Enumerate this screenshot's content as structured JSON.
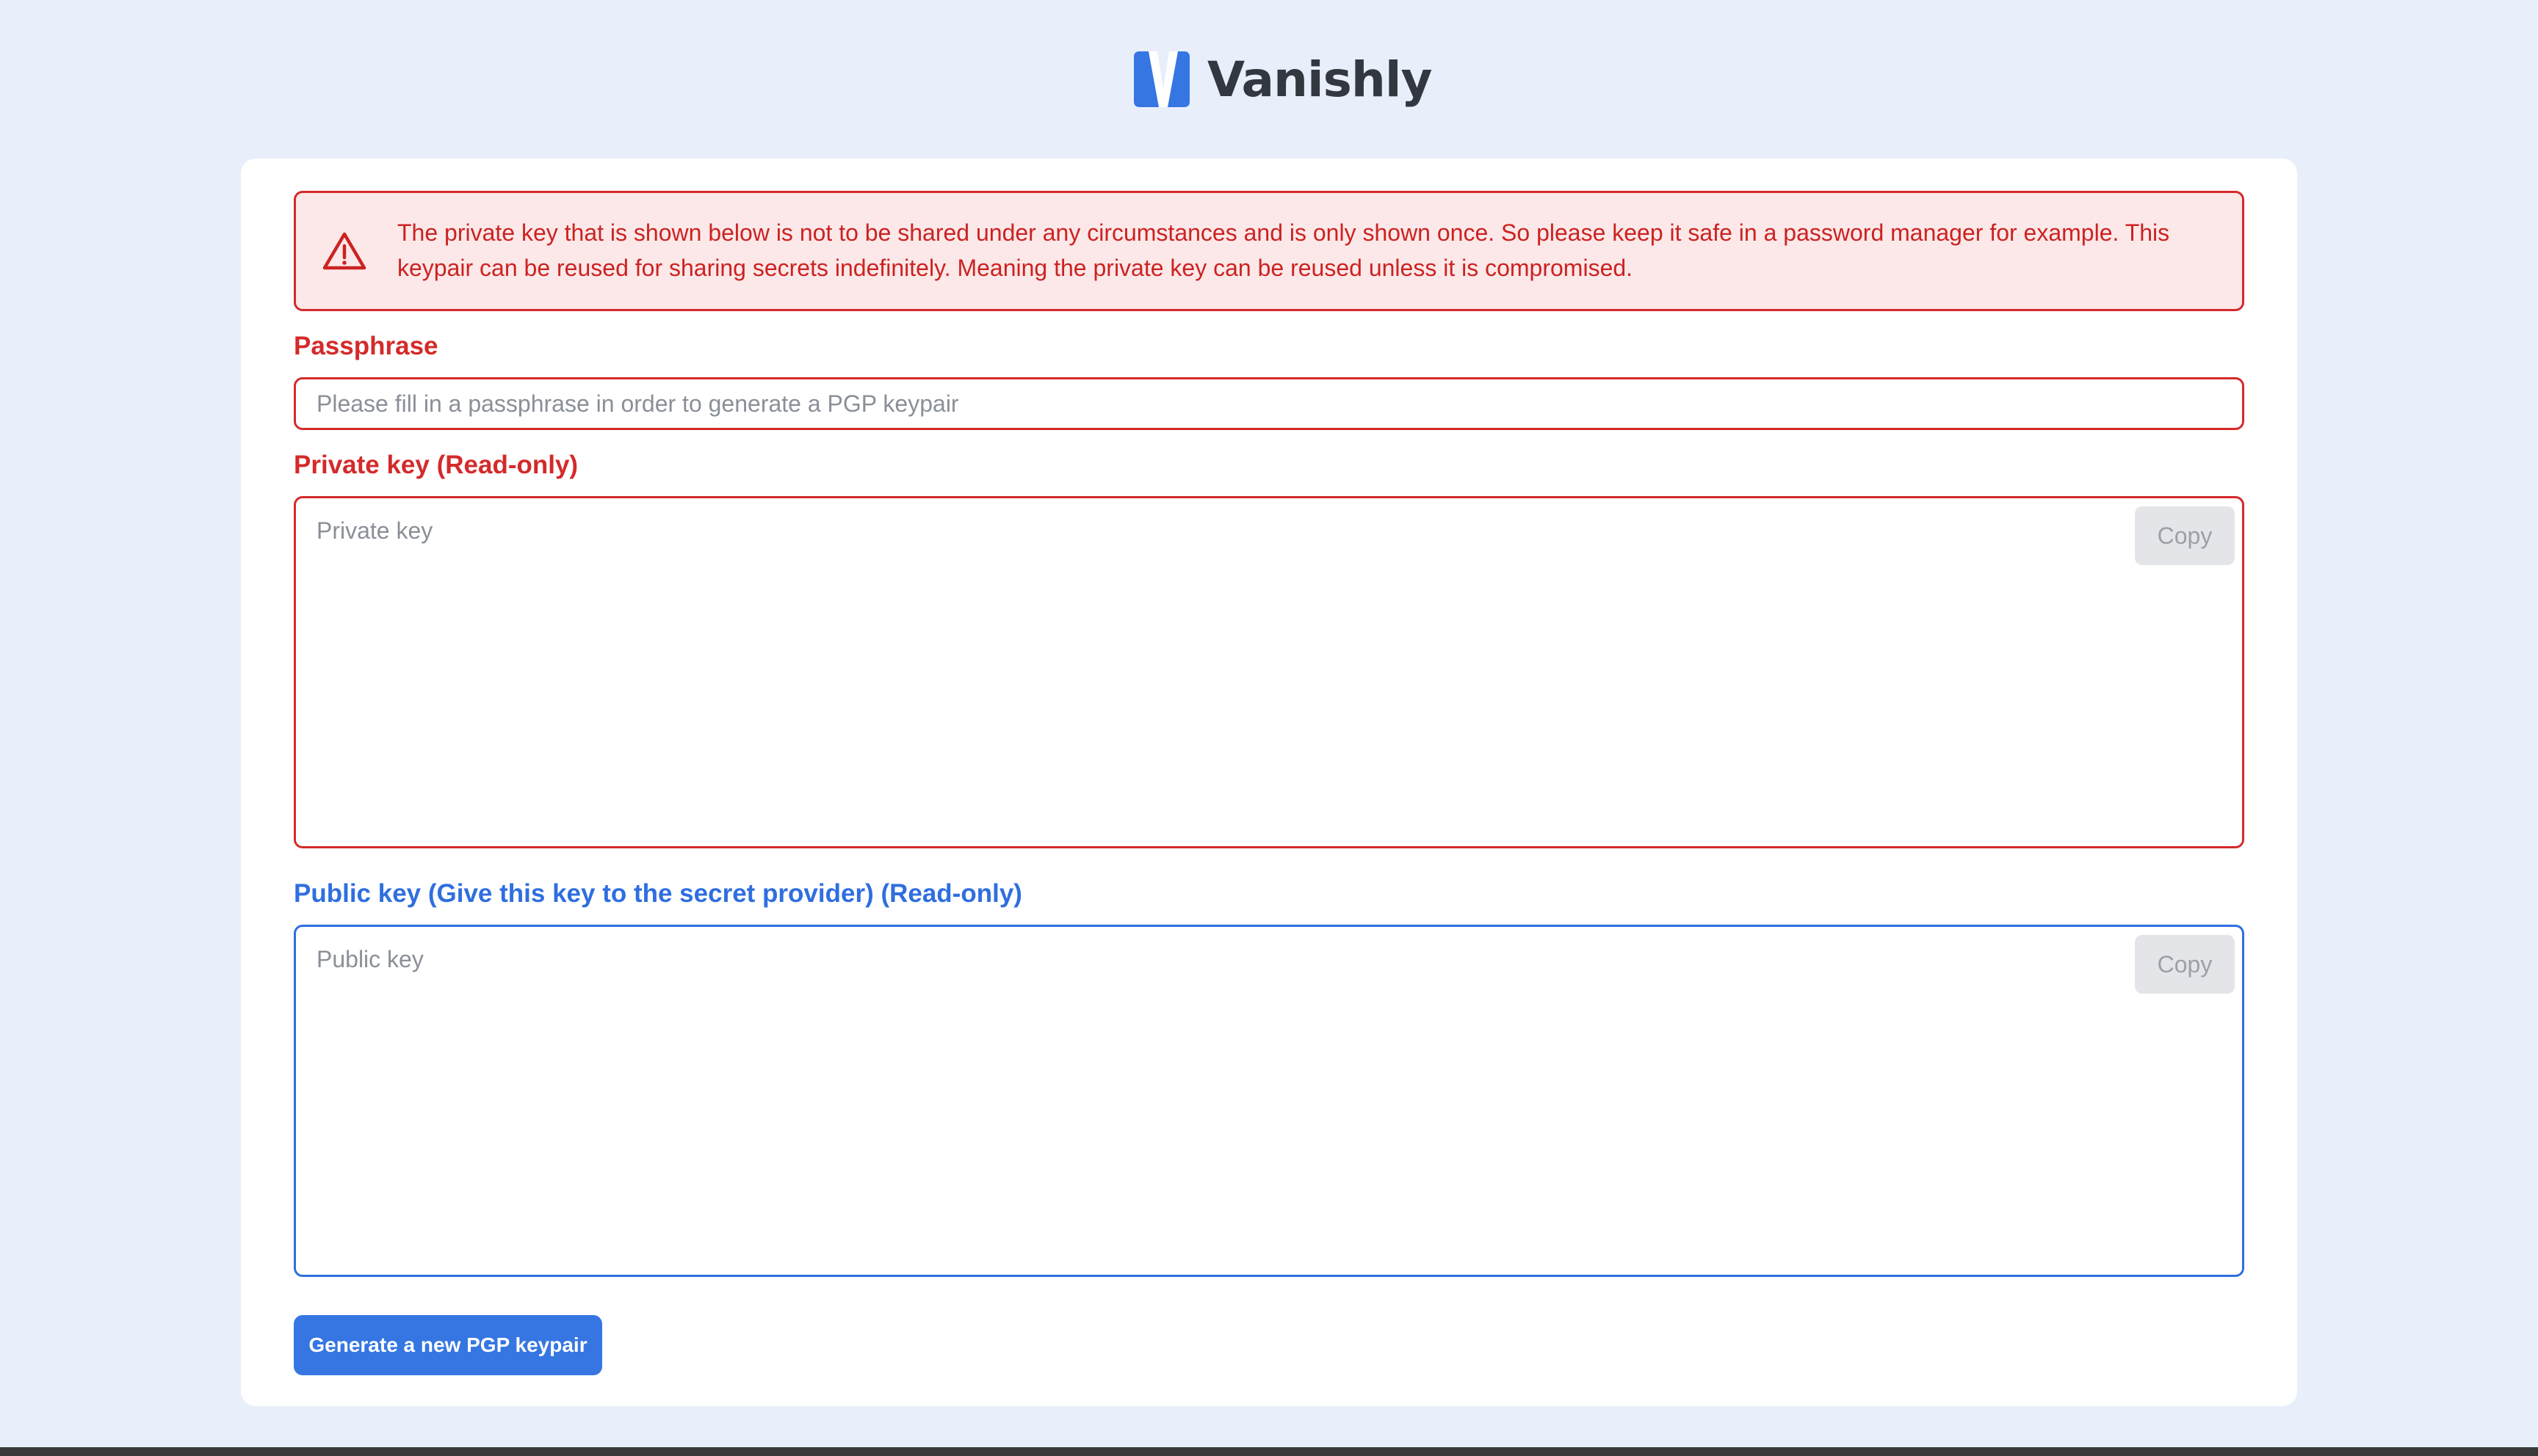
{
  "brand": {
    "name": "Vanishly",
    "logo_icon": "vanishly-v-logo-icon",
    "accent_color": "#3576e3",
    "danger_color": "#d42a2a"
  },
  "alert": {
    "icon": "warning-triangle-icon",
    "text": "The private key that is shown below is not to be shared under any circumstances and is only shown once. So please keep it safe in a password manager for example. This keypair can be reused for sharing secrets indefinitely. Meaning the private key can be reused unless it is compromised."
  },
  "passphrase": {
    "label": "Passphrase",
    "placeholder": "Please fill in a passphrase in order to generate a PGP keypair",
    "value": ""
  },
  "private_key": {
    "label": "Private key (Read-only)",
    "placeholder": "Private key",
    "value": "",
    "copy_label": "Copy"
  },
  "public_key": {
    "label": "Public key (Give this key to the secret provider) (Read-only)",
    "placeholder": "Public key",
    "value": "",
    "copy_label": "Copy"
  },
  "actions": {
    "generate_label": "Generate a new PGP keypair"
  }
}
